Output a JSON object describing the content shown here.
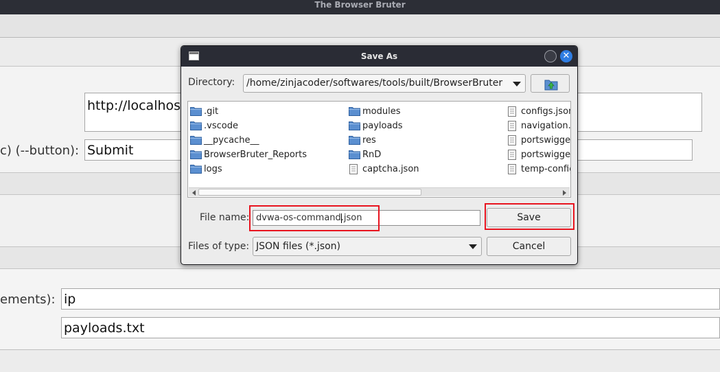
{
  "window": {
    "title": "The Browser Bruter"
  },
  "background": {
    "url_value": "http://localhost",
    "button_label": "c) (--button):",
    "button_value": "Submit",
    "elements_label": "ements):",
    "elements_value": "ip",
    "payloads_value": "payloads.txt"
  },
  "dialog": {
    "title": "Save As",
    "directory_label": "Directory:",
    "directory_value": "/home/zinjacoder/softwares/tools/built/BrowserBruter",
    "files": [
      {
        "name": ".git",
        "type": "folder"
      },
      {
        "name": ".vscode",
        "type": "folder"
      },
      {
        "name": "__pycache__",
        "type": "folder"
      },
      {
        "name": "BrowserBruter_Reports",
        "type": "folder"
      },
      {
        "name": "logs",
        "type": "folder"
      },
      {
        "name": "modules",
        "type": "folder"
      },
      {
        "name": "payloads",
        "type": "folder"
      },
      {
        "name": "res",
        "type": "folder"
      },
      {
        "name": "RnD",
        "type": "folder"
      },
      {
        "name": "captcha.json",
        "type": "file"
      },
      {
        "name": "configs.json",
        "type": "file"
      },
      {
        "name": "navigation.",
        "type": "file"
      },
      {
        "name": "portswigge",
        "type": "file"
      },
      {
        "name": "portswigge",
        "type": "file"
      },
      {
        "name": "temp-config",
        "type": "file"
      }
    ],
    "filename_label": "File name:",
    "filename_value": "dvwa-os-command.json",
    "filetype_label": "Files of type:",
    "filetype_value": "JSON files (*.json)",
    "save_label": "Save",
    "cancel_label": "Cancel"
  },
  "colors": {
    "highlight": "#e8141f",
    "folder_icon": "#5b8fd0",
    "close_button": "#2f7de2"
  }
}
